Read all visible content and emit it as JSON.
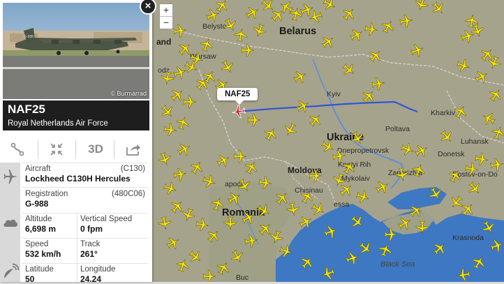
{
  "map": {
    "zoom_in": "+",
    "zoom_out": "−",
    "callsign_label": "NAF25",
    "cities": {
      "belarus": "Belarus",
      "belarus_top": "Belysto",
      "warsaw": "Warsaw",
      "lodz": "odz",
      "and": "and",
      "kyiv": "Kyiv",
      "kharkiv": "Kharkiv",
      "poltava": "Poltava",
      "ukraine": "Ukraine",
      "dnepro": "Dnepropetrovsk",
      "kryvyi": "Kryvyi Rih",
      "zaporizhia": "Zaporizhia",
      "donetsk": "Donetsk",
      "luhansk": "Luhansk",
      "rostov": "Rostov-on-Do",
      "moldova": "Moldova",
      "chisinau": "Chisinau",
      "mykolaiv": "Mykolaiv",
      "odessa": "essa",
      "apoca": "apoca",
      "romania": "Romania",
      "krasnodar": "Krasnoda",
      "black_sea": "Black Sea",
      "buc": "Buc"
    }
  },
  "flight": {
    "photo_credit": "© Burmarrad",
    "callsign": "NAF25",
    "airline": "Royal Netherlands Air Force",
    "close_label": "×",
    "toolbar": {
      "route_icon": "route-icon",
      "fullscreen_icon": "collapse-icon",
      "three_d": "3D",
      "share_icon": "share-icon"
    },
    "aircraft_label": "Aircraft",
    "aircraft_code": "(C130)",
    "aircraft_value": "Lockheed C130H Hercules",
    "registration_label": "Registration",
    "registration_code": "(480C06)",
    "registration_value": "G-988",
    "altitude_label": "Altitude",
    "altitude_value": "6,698 m",
    "vspeed_label": "Vertical Speed",
    "vspeed_value": "0 fpm",
    "speed_label": "Speed",
    "speed_value": "532 km/h",
    "track_label": "Track",
    "track_value": "261°",
    "lat_label": "Latitude",
    "lat_value": "50",
    "lon_label": "Longitude",
    "lon_value": "24.24"
  },
  "colors": {
    "flight_path": "#2f55d6",
    "aircraft_marker": "#f4e20a",
    "selected_marker": "#c41e2a"
  }
}
